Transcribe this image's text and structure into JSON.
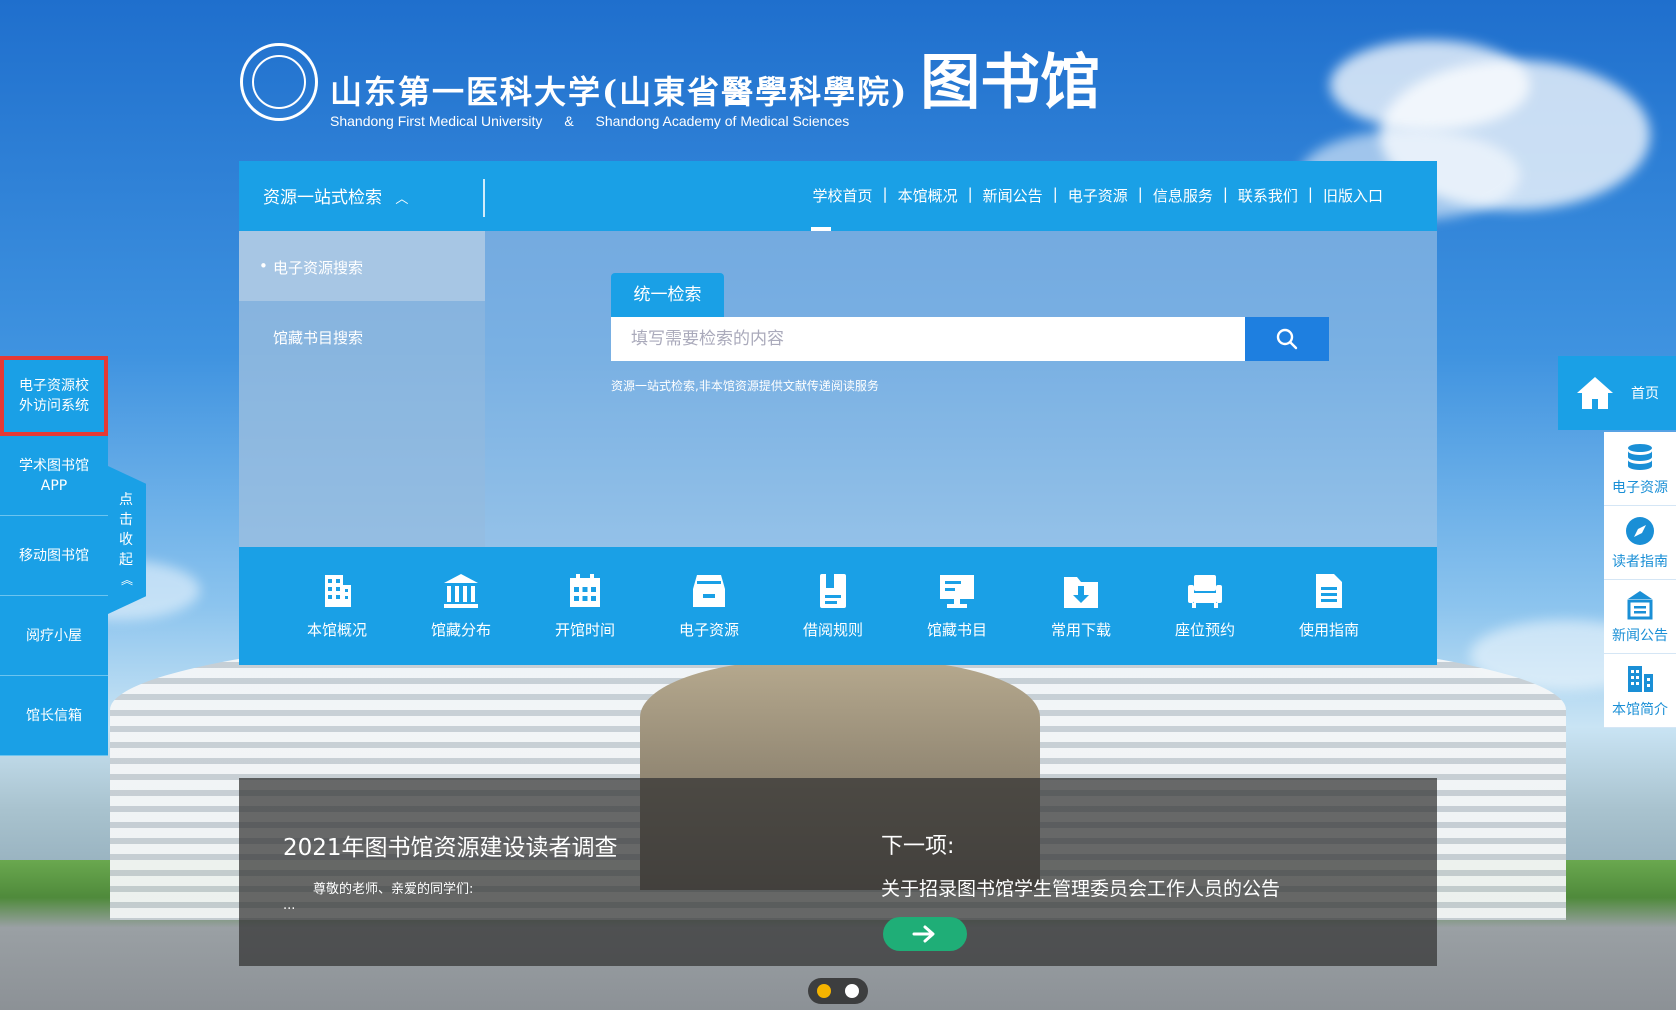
{
  "header": {
    "title_cn": "山东第一医科大学(山東省醫學科學院)",
    "title_big": "图书馆",
    "title_en_1": "Shandong First Medical University",
    "title_en_amp": "&",
    "title_en_2": "Shandong Academy of Medical Sciences"
  },
  "topbar": {
    "onestop_label": "资源一站式检索",
    "nav": [
      "学校首页",
      "本馆概况",
      "新闻公告",
      "电子资源",
      "信息服务",
      "联系我们",
      "旧版入口"
    ],
    "nav_active_index": 0
  },
  "search": {
    "tabs": [
      "电子资源搜索",
      "馆藏书目搜索"
    ],
    "active_tab": "统一检索",
    "placeholder": "填写需要检索的内容",
    "note": "资源一站式检索,非本馆资源提供文献传递阅读服务"
  },
  "quick_links": [
    {
      "label": "本馆概况",
      "icon": "building-icon"
    },
    {
      "label": "馆藏分布",
      "icon": "museum-icon"
    },
    {
      "label": "开馆时间",
      "icon": "calendar-icon"
    },
    {
      "label": "电子资源",
      "icon": "archive-box-icon"
    },
    {
      "label": "借阅规则",
      "icon": "book-icon"
    },
    {
      "label": "馆藏书目",
      "icon": "monitor-icon"
    },
    {
      "label": "常用下载",
      "icon": "download-folder-icon"
    },
    {
      "label": "座位预约",
      "icon": "seat-icon"
    },
    {
      "label": "使用指南",
      "icon": "document-icon"
    }
  ],
  "news": {
    "current_title": "2021年图书馆资源建设读者调查",
    "current_desc": "尊敬的老师、亲爱的同学们:",
    "current_ellipsis": "...",
    "next_label": "下一项:",
    "next_title": "关于招录图书馆学生管理委员会工作人员的公告",
    "slide_count": 2,
    "active_slide": 1
  },
  "left_sidebar": {
    "items": [
      "电子资源校外访问系统",
      "学术图书馆APP",
      "移动图书馆",
      "阅疗小屋",
      "馆长信箱"
    ],
    "highlighted_index": 0,
    "collapse_label": "点击收起"
  },
  "right_sidebar": {
    "home_label": "首页",
    "items": [
      {
        "label": "电子资源",
        "icon": "database-icon"
      },
      {
        "label": "读者指南",
        "icon": "compass-icon"
      },
      {
        "label": "新闻公告",
        "icon": "news-icon"
      },
      {
        "label": "本馆简介",
        "icon": "info-building-icon"
      }
    ]
  },
  "colors": {
    "primary_blue": "#1aa0e6",
    "search_button": "#1e7fe0",
    "next_button": "#1fae77",
    "highlight_border": "#e53935",
    "active_dot": "#f5b400"
  }
}
